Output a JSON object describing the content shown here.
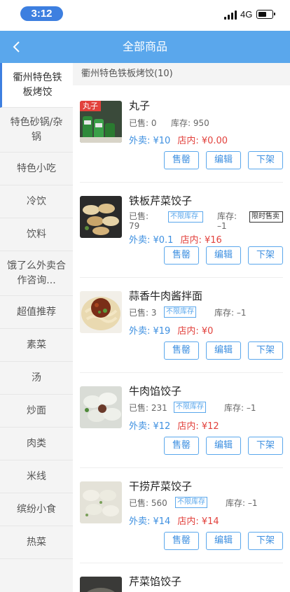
{
  "status_bar": {
    "time": "3:12",
    "network": "4G",
    "signal_icon": "signal-icon",
    "battery_icon": "battery-icon"
  },
  "header": {
    "title": "全部商品",
    "back_icon": "chevron-left-icon"
  },
  "colors": {
    "accent": "#5aa7ec",
    "price_out": "#3d8fe0",
    "price_in": "#e2413c",
    "tag_bg": "#e2413c"
  },
  "sidebar": {
    "items": [
      {
        "label": "衢州特色铁板烤饺",
        "active": true
      },
      {
        "label": "特色砂锅/杂锅"
      },
      {
        "label": "特色小吃"
      },
      {
        "label": "冷饮"
      },
      {
        "label": "饮料"
      },
      {
        "label": "饿了么外卖合作咨询..."
      },
      {
        "label": "超值推荐"
      },
      {
        "label": "素菜"
      },
      {
        "label": "汤"
      },
      {
        "label": "炒面"
      },
      {
        "label": "肉类"
      },
      {
        "label": "米线"
      },
      {
        "label": "缤纷小食"
      },
      {
        "label": "热菜"
      }
    ]
  },
  "section": {
    "title": "衢州特色铁板烤饺(10)"
  },
  "buttons": {
    "sold_out": "售罄",
    "edit": "编辑",
    "offline": "下架"
  },
  "products": [
    {
      "name": "丸子",
      "tag": "丸子",
      "sold": "已售: 0",
      "stock": "库存: 950",
      "out_price": "外卖: ¥10",
      "in_price": "店内: ¥0.00"
    },
    {
      "name": "铁板芹菜饺子",
      "sold": "已售: 79",
      "badge": "不限库存",
      "stock": "库存: –1",
      "badge2": "限时售卖",
      "out_price": "外卖: ¥0.1",
      "in_price": "店内: ¥16"
    },
    {
      "name": "蒜香牛肉酱拌面",
      "sold": "已售: 3",
      "badge": "不限库存",
      "stock": "库存: –1",
      "out_price": "外卖: ¥19",
      "in_price": "店内: ¥0"
    },
    {
      "name": "牛肉馅饺子",
      "sold": "已售: 231",
      "badge": "不限库存",
      "stock": "库存: –1",
      "out_price": "外卖: ¥12",
      "in_price": "店内: ¥12"
    },
    {
      "name": "干捞芹菜饺子",
      "sold": "已售: 560",
      "badge": "不限库存",
      "stock": "库存: –1",
      "out_price": "外卖: ¥14",
      "in_price": "店内: ¥14"
    },
    {
      "name": "芹菜馅饺子"
    }
  ]
}
